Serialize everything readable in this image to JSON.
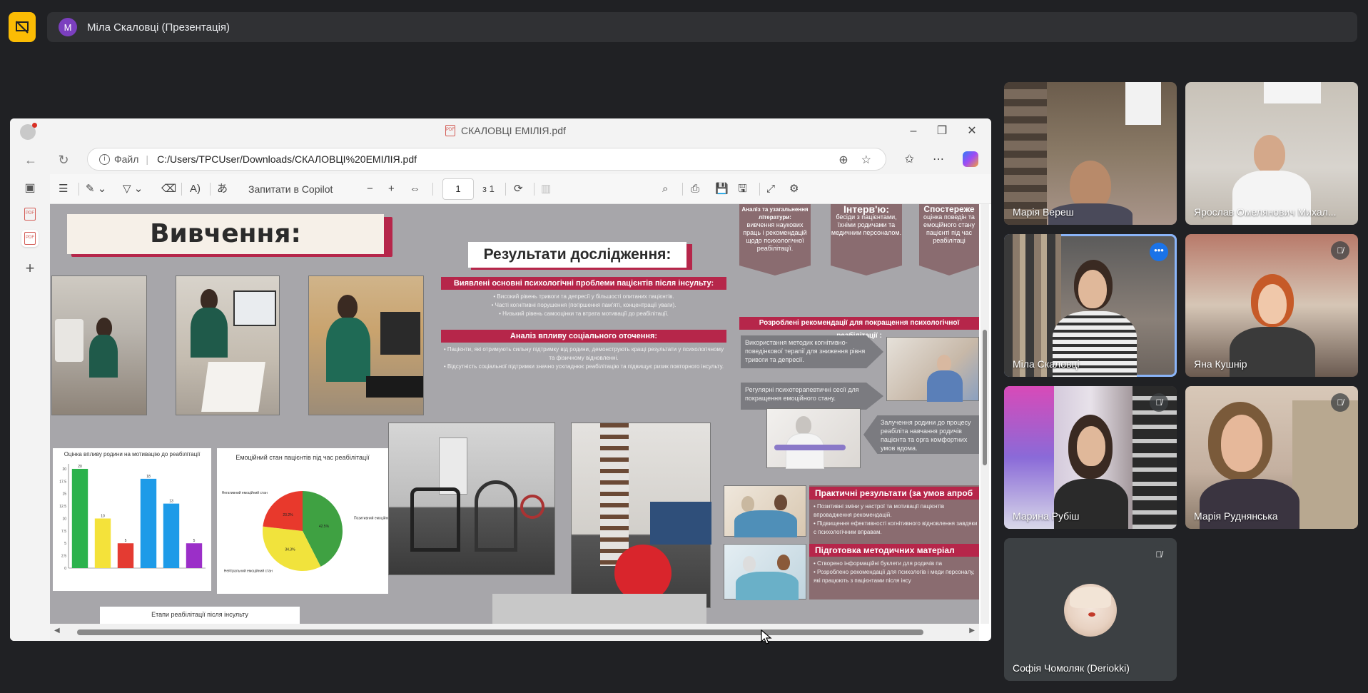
{
  "presenter_bar": {
    "avatar_letter": "M",
    "label": "Міла Скаловці (Презентація)"
  },
  "browser": {
    "tab_title": "СКАЛОВЦІ ЕМІЛІЯ.pdf",
    "url_scheme": "Файл",
    "url_path": "C:/Users/TPCUser/Downloads/СКАЛОВЦІ%20ЕМІЛІЯ.pdf",
    "toolbar": {
      "copilot_label": "Запитати в Copilot",
      "page_current": "1",
      "page_total": "з 1"
    }
  },
  "poster": {
    "heading_study": "Вивчення:",
    "heading_results": "Результати дослідження:",
    "bar_problems": "Виявлені основні психологічні проблеми пацієнтів після інсульту:",
    "problems_text": "• Високий рівень тривоги та депресії у більшості опитаних пацієнтів.\n• Часті когнітивні порушення (погіршення пам'яті, концентрації уваги).\n• Низький рівень самооцінки та втрата мотивації до реабілітації.",
    "bar_social": "Аналіз впливу соціального оточення:",
    "social_text": "• Пацієнти, які отримують сильну підтримку від родини, демонструють кращі результати у психологічному та фізичному відновленні.\n• Відсутність соціальної підтримки значно ускладнює реабілітацію та підвищує ризик повторного інсульту.",
    "flag_1_title": "Аналіз та узагальнення літератури:",
    "flag_1_text": "вивчення наукових праць і рекомендацій щодо психологічної реабілітації.",
    "flag_2_title": "Інтерв'ю:",
    "flag_2_text": "бесіди з пацієнтами, їхніми родичами та медичним персоналом.",
    "flag_3_title": "Спостереже",
    "flag_3_text": "оцінка поведін та емоційного стану пацієнті під час реабілітаці",
    "bar_recommend": "Розроблені рекомендації для покращення психологічної реабілітації :",
    "rec_1": "Використання методик когнітивно-поведінкової терапії для зниження рівня тривоги та депресії.",
    "rec_2": "Регулярні психотерапевтичні сесії для покращення емоційного стану.",
    "rec_3": "Залучення родини до процесу реабіліта навчання родичів пацієнта та орга комфортних умов вдома.",
    "bar_practical": "Практичні результати (за умов апроб",
    "practical_text": "• Позитивні зміни у настрої та мотивації пацієнтів впровадження рекомендацій.\n• Підвищення ефективності когнітивного відновлення завдяки с психологічним вправам.",
    "bar_method": "Підготовка методичних матеріал",
    "method_text": "• Створено інформаційні буклети для родичів па\n• Розроблено рекомендації для психологів і меди персоналу, які працюють з пацієнтами після інсу",
    "bar_chart_title": "Оцінка впливу родини на мотивацію до реабілітації",
    "pie_chart_title": "Емоційний стан пацієнтів під час реабілітації",
    "stages_title": "Етапи реабілітації після інсульту"
  },
  "chart_data": [
    {
      "type": "bar",
      "title": "Оцінка впливу родини на мотивацію до реабілітації",
      "values": [
        20,
        10,
        5,
        18,
        13,
        5
      ],
      "colors": [
        "#2bb24c",
        "#f4e23a",
        "#e43b32",
        "#1e9be8",
        "#1e9be8",
        "#9b2fc8"
      ],
      "ylim": [
        0,
        21
      ],
      "yticks": [
        0,
        2.5,
        5.0,
        7.5,
        10.0,
        12.5,
        15.0,
        17.5,
        20.0
      ]
    },
    {
      "type": "pie",
      "title": "Емоційний стан пацієнтів під час реабілітації",
      "slices": [
        {
          "label": "Позитивний емоційний стан",
          "value": 42.5,
          "color": "#3fa142"
        },
        {
          "label": "Нейтральний емоційний стан",
          "value": 34.3,
          "color": "#f1e33c"
        },
        {
          "label": "Негативний емоційний стан",
          "value": 23.2,
          "color": "#e8392c"
        }
      ],
      "pct_labels": [
        "42.5%",
        "34.3%",
        "23.2%"
      ]
    }
  ],
  "participants": [
    {
      "name": "Марія Вереш",
      "muted": false,
      "active": false
    },
    {
      "name": "Ярослав Омелянович Михал...",
      "muted": false,
      "active": false
    },
    {
      "name": "Міла Скаловці",
      "muted": false,
      "active": true
    },
    {
      "name": "Яна Кушнір",
      "muted": true,
      "active": false
    },
    {
      "name": "Марина Рубіш",
      "muted": true,
      "active": false
    },
    {
      "name": "Марія Руднянська",
      "muted": true,
      "active": false
    },
    {
      "name": "Софія Чомоляк (Deriokki)",
      "muted": true,
      "active": false
    }
  ]
}
